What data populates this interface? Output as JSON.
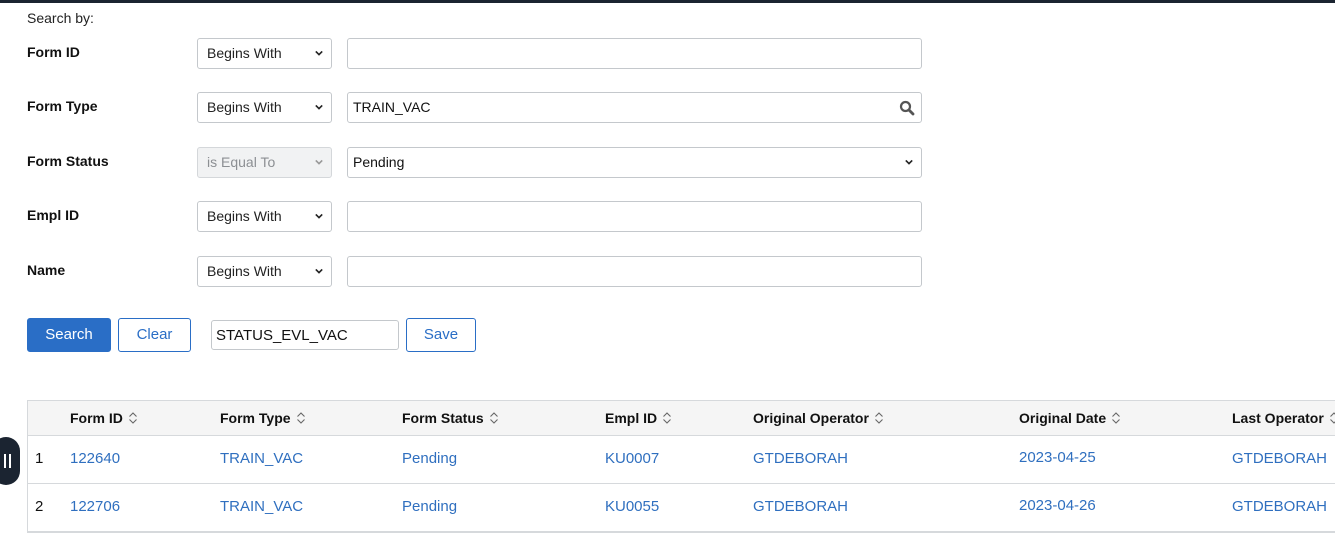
{
  "search": {
    "heading": "Search by:",
    "fields": [
      {
        "label": "Form ID",
        "operator": "Begins With",
        "operator_disabled": false,
        "value": "",
        "kind": "text"
      },
      {
        "label": "Form Type",
        "operator": "Begins With",
        "operator_disabled": false,
        "value": "TRAIN_VAC",
        "kind": "lookup"
      },
      {
        "label": "Form Status",
        "operator": "is Equal To",
        "operator_disabled": true,
        "value": "Pending",
        "kind": "dropdown"
      },
      {
        "label": "Empl ID",
        "operator": "Begins With",
        "operator_disabled": false,
        "value": "",
        "kind": "text"
      },
      {
        "label": "Name",
        "operator": "Begins With",
        "operator_disabled": false,
        "value": "",
        "kind": "text"
      }
    ],
    "search_label": "Search",
    "clear_label": "Clear",
    "saved_search_name": "STATUS_EVL_VAC",
    "save_label": "Save"
  },
  "results": {
    "columns": [
      "Form ID",
      "Form Type",
      "Form Status",
      "Empl ID",
      "Original Operator",
      "Original Date",
      "Last Operator"
    ],
    "rows": [
      {
        "num": "1",
        "form_id": "122640",
        "form_type": "TRAIN_VAC",
        "form_status": "Pending",
        "empl_id": "KU0007",
        "orig_operator": "GTDEBORAH",
        "orig_date": "2023-04-25",
        "last_operator": "GTDEBORAH"
      },
      {
        "num": "2",
        "form_id": "122706",
        "form_type": "TRAIN_VAC",
        "form_status": "Pending",
        "empl_id": "KU0055",
        "orig_operator": "GTDEBORAH",
        "orig_date": "2023-04-26",
        "last_operator": "GTDEBORAH"
      }
    ]
  },
  "icons": {
    "sort": "sort-arrows-icon",
    "lookup": "magnifier-icon",
    "dropdown": "chevron-down-icon",
    "drag": "drag-handle-icon"
  },
  "colors": {
    "accent": "#2a6ec6",
    "link": "#2f6fbf",
    "topbar": "#1b2431"
  }
}
